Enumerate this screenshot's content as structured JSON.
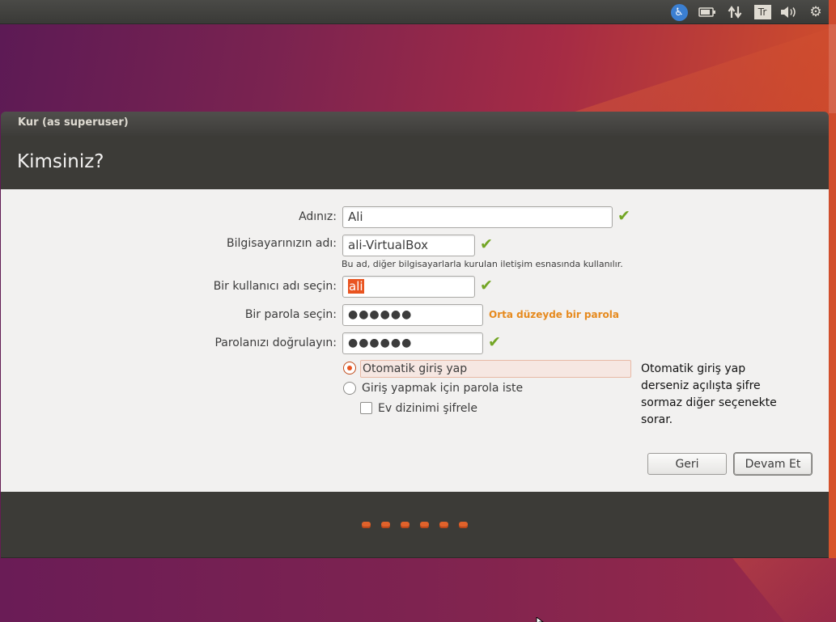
{
  "panel": {
    "indicators": {
      "accessibility": "♿",
      "battery": "▭",
      "network": "⇅",
      "keyboard": "Tr",
      "sound": "🔊",
      "settings": "⚙"
    }
  },
  "window": {
    "title": "Kur (as superuser)",
    "heading": "Kimsiniz?",
    "form": {
      "name_label": "Adınız:",
      "name_value": "Ali",
      "computer_label": "Bilgisayarınızın adı:",
      "computer_value": "ali-VirtualBox",
      "computer_hint": "Bu ad, diğer bilgisayarlarla kurulan iletişim esnasında kullanılır.",
      "username_label": "Bir kullanıcı adı seçin:",
      "username_value": "ali",
      "password_label": "Bir parola seçin:",
      "password_value": "●●●●●●",
      "password_strength": "Orta düzeyde bir parola",
      "confirm_label": "Parolanızı doğrulayın:",
      "confirm_value": "●●●●●●",
      "check_mark": "✔"
    },
    "options": {
      "auto_login": "Otomatik giriş yap",
      "require_password": "Giriş yapmak için parola iste",
      "encrypt_home": "Ev dizinimi şifrele"
    },
    "note": "Otomatik giriş yap derseniz açılışta şifre sormaz diğer seçenekte sorar.",
    "buttons": {
      "back": "Geri",
      "continue": "Devam Et"
    }
  },
  "colors": {
    "accent": "#e95420",
    "check": "#73a625",
    "strength": "#e68a1e",
    "dark_panel": "#3c3b37"
  }
}
